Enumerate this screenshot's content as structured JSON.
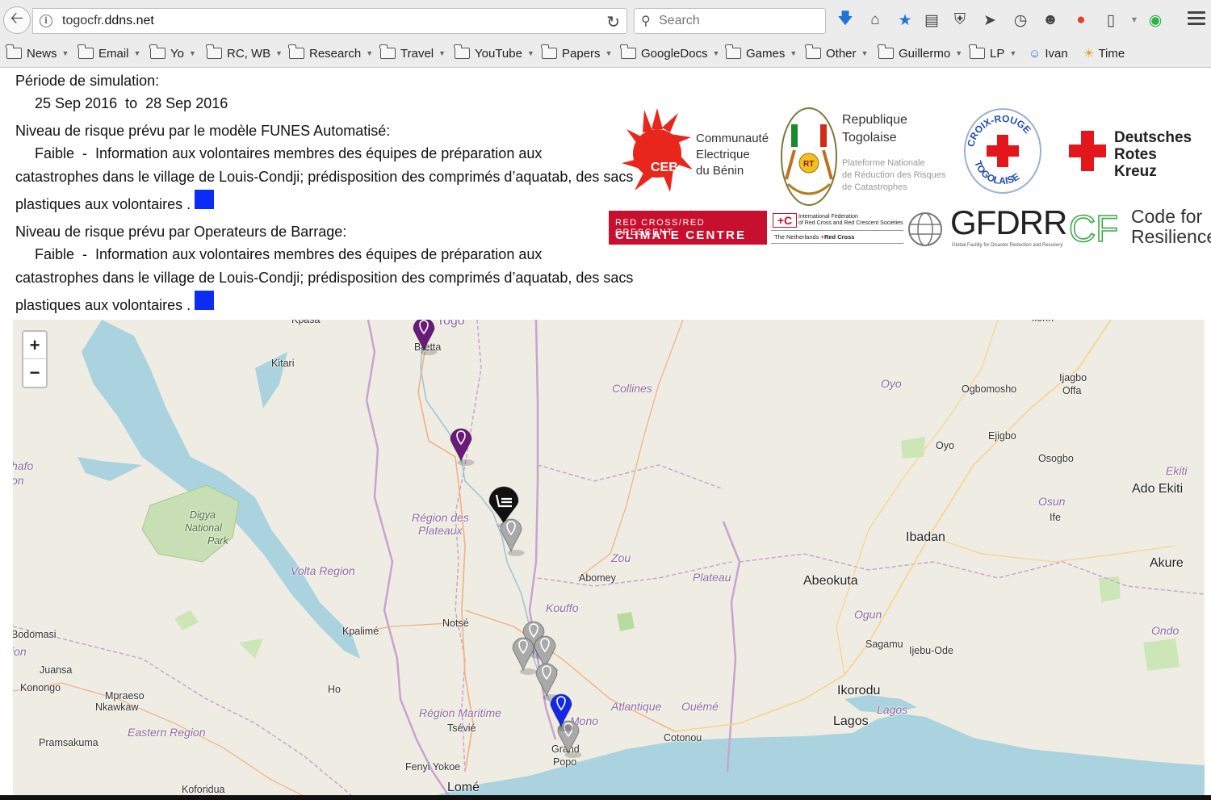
{
  "browser": {
    "url_host": "togocfr.",
    "url_domain": "ddns.net",
    "search_placeholder": "Search",
    "bookmarks": [
      {
        "label": "News",
        "folder": true
      },
      {
        "label": "Email",
        "folder": true
      },
      {
        "label": "Yo",
        "folder": true
      },
      {
        "label": "RC, WB",
        "folder": true
      },
      {
        "label": "Research",
        "folder": true
      },
      {
        "label": "Travel",
        "folder": true
      },
      {
        "label": "YouTube",
        "folder": true
      },
      {
        "label": "Papers",
        "folder": true
      },
      {
        "label": "GoogleDocs",
        "folder": true
      },
      {
        "label": "Games",
        "folder": true
      },
      {
        "label": "Other",
        "folder": true
      },
      {
        "label": "Guillermo",
        "folder": true
      },
      {
        "label": "LP",
        "folder": true
      },
      {
        "label": "Ivan",
        "folder": false
      },
      {
        "label": "Time",
        "folder": false
      }
    ]
  },
  "simulation": {
    "period_label": "Période de simulation:",
    "period_from": "25 Sep 2016",
    "period_to_word": "to",
    "period_to": "28 Sep 2016",
    "funes_heading": "Niveau de risque prévu par le modèle FUNES Automatisé:",
    "funes_level": "Faible",
    "funes_line1": "Information aux volontaires membres des équipes de préparation aux",
    "funes_line2": "catastrophes dans le village de Louis-Condji; prédisposition des comprimés d’aquatab, des sacs",
    "funes_line3": "plastiques aux volontaires .",
    "dam_heading": "Niveau de risque prévu par Operateurs de Barrage:",
    "dam_level": "Faible",
    "dam_line1": "Information aux volontaires membres des équipes de préparation aux",
    "dam_line2": "catastrophes dans le village de Louis-Condji; prédisposition des comprimés d’aquatab, des sacs",
    "dam_line3": "plastiques aux volontaires .",
    "risk_color": "#0a2cf5"
  },
  "logos": {
    "ceb": [
      "Communauté",
      "Electrique",
      "du Bénin"
    ],
    "ceb_mark": "CEB",
    "rt_title": [
      "Republique",
      "Togolaise"
    ],
    "rt_badge": "RT",
    "rt_sub": [
      "Plateforme Nationale",
      "de Réduction des Risques",
      "de Catastrophes"
    ],
    "croix_rouge_top": "CROIX-ROUGE",
    "croix_rouge_bottom": "TOGOLAISE",
    "drk": [
      "Deutsches",
      "Rotes",
      "Kreuz"
    ],
    "climate_centre_l1": "RED CROSS/RED CRESCENT",
    "climate_centre_l2": "CLIMATE CENTRE",
    "ifrc_l1": "International Federation",
    "ifrc_l2": "of Red Cross and Red Crescent Societies",
    "ifrc_l3": "The Netherlands",
    "ifrc_l4": "Red Cross",
    "gfdrr": "GFDRR",
    "gfdrr_sub": "Global Facility for Disaster Reduction and Recovery",
    "cfr_mark": "CFR",
    "cfr": [
      "Code for",
      "Resilience"
    ]
  },
  "map": {
    "zoom_in": "+",
    "zoom_out": "−",
    "labels": [
      {
        "text": "Kpasa",
        "kind": "town"
      },
      {
        "text": "Togo",
        "kind": "country"
      },
      {
        "text": "Bætta",
        "kind": "town"
      },
      {
        "text": "Kitari",
        "kind": "town"
      },
      {
        "text": "Collines",
        "kind": "region"
      },
      {
        "text": "Oyo",
        "kind": "region"
      },
      {
        "text": "Ogbomosho",
        "kind": "town"
      },
      {
        "text": "Ijagbo",
        "kind": "town"
      },
      {
        "text": "Offa",
        "kind": "town"
      },
      {
        "text": "Ilorin",
        "kind": "town"
      },
      {
        "text": "Ejigbo",
        "kind": "town"
      },
      {
        "text": "Oyo",
        "kind": "town"
      },
      {
        "text": "Osogbo",
        "kind": "town"
      },
      {
        "text": "Ekiti",
        "kind": "region"
      },
      {
        "text": "Ado Ekiti",
        "kind": "city"
      },
      {
        "text": "hafo",
        "kind": "region"
      },
      {
        "text": "on",
        "kind": "region"
      },
      {
        "text": "Digya",
        "kind": "park"
      },
      {
        "text": "National",
        "kind": "park"
      },
      {
        "text": "Park",
        "kind": "park"
      },
      {
        "text": "Région des",
        "kind": "region"
      },
      {
        "text": "Plateaux",
        "kind": "region"
      },
      {
        "text": "Osun",
        "kind": "region"
      },
      {
        "text": "Ife",
        "kind": "town"
      },
      {
        "text": "Ibadan",
        "kind": "city"
      },
      {
        "text": "Zou",
        "kind": "region"
      },
      {
        "text": "Abomey",
        "kind": "town"
      },
      {
        "text": "Plateau",
        "kind": "region"
      },
      {
        "text": "Volta Region",
        "kind": "region"
      },
      {
        "text": "Abeokuta",
        "kind": "city"
      },
      {
        "text": "Akure",
        "kind": "city"
      },
      {
        "text": "Kouffo",
        "kind": "region"
      },
      {
        "text": "Ogun",
        "kind": "region"
      },
      {
        "text": "Notsé",
        "kind": "town"
      },
      {
        "text": "Kpalimé",
        "kind": "town"
      },
      {
        "text": "Bodomasi",
        "kind": "town"
      },
      {
        "text": "ion",
        "kind": "region"
      },
      {
        "text": "Ondo",
        "kind": "region"
      },
      {
        "text": "Sagamu",
        "kind": "town"
      },
      {
        "text": "Ijebu-Ode",
        "kind": "town"
      },
      {
        "text": "Juansa",
        "kind": "town"
      },
      {
        "text": "Konongo",
        "kind": "town"
      },
      {
        "text": "Mpraeso",
        "kind": "town"
      },
      {
        "text": "Nkawkaw",
        "kind": "town"
      },
      {
        "text": "Ho",
        "kind": "town"
      },
      {
        "text": "Ikorodu",
        "kind": "city"
      },
      {
        "text": "Région Maritime",
        "kind": "region"
      },
      {
        "text": "Atlantique",
        "kind": "region"
      },
      {
        "text": "Ouémé",
        "kind": "region"
      },
      {
        "text": "Lagos",
        "kind": "region"
      },
      {
        "text": "Mono",
        "kind": "region"
      },
      {
        "text": "Tsévié",
        "kind": "town"
      },
      {
        "text": "Eastern Region",
        "kind": "region"
      },
      {
        "text": "Lagos",
        "kind": "city"
      },
      {
        "text": "Cotonou",
        "kind": "town"
      },
      {
        "text": "Pramsakuma",
        "kind": "town"
      },
      {
        "text": "Grand",
        "kind": "town"
      },
      {
        "text": "Popo",
        "kind": "town"
      },
      {
        "text": "Fenyi Yokoe",
        "kind": "town"
      },
      {
        "text": "Koforidua",
        "kind": "town"
      },
      {
        "text": "Lomé",
        "kind": "city"
      }
    ],
    "markers": [
      {
        "kind": "station",
        "color": "#6a1a78"
      },
      {
        "kind": "station",
        "color": "#6a1a78"
      },
      {
        "kind": "dam",
        "color": "#111111"
      },
      {
        "kind": "village",
        "color": "#a9a9a9"
      },
      {
        "kind": "village",
        "color": "#a9a9a9"
      },
      {
        "kind": "village",
        "color": "#a9a9a9"
      },
      {
        "kind": "village",
        "color": "#a9a9a9"
      },
      {
        "kind": "village",
        "color": "#a9a9a9"
      },
      {
        "kind": "village",
        "color": "#a9a9a9"
      },
      {
        "kind": "selected",
        "color": "#1428e6"
      }
    ]
  }
}
